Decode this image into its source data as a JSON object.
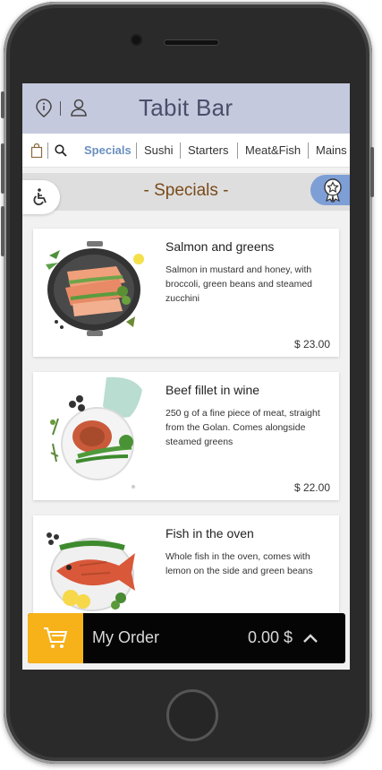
{
  "app": {
    "title": "Tabit Bar"
  },
  "header": {
    "icons": [
      "info-icon",
      "user-icon"
    ]
  },
  "categories": {
    "icons": [
      "bag-icon",
      "search-icon"
    ],
    "items": [
      {
        "label": "Specials",
        "active": true
      },
      {
        "label": "Sushi",
        "active": false
      },
      {
        "label": "Starters",
        "active": false
      },
      {
        "label": "Meat&Fish",
        "active": false
      },
      {
        "label": "Mains",
        "active": false
      }
    ]
  },
  "section": {
    "title": "- Specials -",
    "left_icon": "wheelchair-icon",
    "right_icon": "award-icon"
  },
  "menu": {
    "items": [
      {
        "name": "Salmon and greens",
        "description": "Salmon in mustard and honey, with broccoli, green beans and steamed zucchini",
        "price": "$ 23.00"
      },
      {
        "name": "Beef fillet in wine",
        "description": "250 g of a fine piece of meat, straight from the Golan. Comes alongside steamed greens",
        "price": "$ 22.00"
      },
      {
        "name": "Fish in the oven",
        "description": "Whole fish in the oven, comes with lemon on the side and green beans",
        "price": ""
      }
    ]
  },
  "order": {
    "label": "My Order",
    "total": "0.00 $",
    "cart_icon": "cart-icon",
    "expand_icon": "chevron-up-icon"
  },
  "colors": {
    "header_bg": "#c5c9dd",
    "accent": "#6a8fbf",
    "section_title": "#7a4a1a",
    "cart": "#f7b21a",
    "order_bar": "#050505"
  }
}
